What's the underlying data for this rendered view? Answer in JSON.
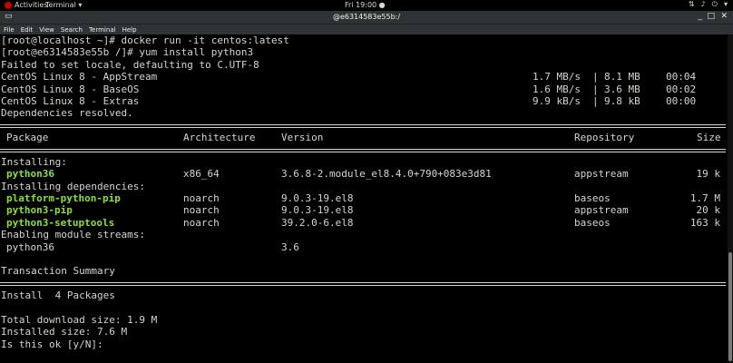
{
  "topbar": {
    "activities": "Activities",
    "app": "Terminal ▾",
    "clock": "Fri 19:00 ●"
  },
  "window": {
    "title": "@e6314583e55b:/"
  },
  "menu": [
    "File",
    "Edit",
    "View",
    "Search",
    "Terminal",
    "Help"
  ],
  "terminal": {
    "cmd1": "[root@localhost ~]# docker run -it centos:latest",
    "cmd2": "[root@e6314583e55b /]# yum install python3",
    "locale": "Failed to set locale, defaulting to C.UTF-8",
    "repos": [
      {
        "name": "CentOS Linux 8 - AppStream",
        "speed": "1.7 MB/s",
        "size": "8.1 MB",
        "time": "00:04"
      },
      {
        "name": "CentOS Linux 8 - BaseOS",
        "speed": "1.6 MB/s",
        "size": "3.6 MB",
        "time": "00:02"
      },
      {
        "name": "CentOS Linux 8 - Extras",
        "speed": "9.9 kB/s",
        "size": "9.8 kB",
        "time": "00:00"
      }
    ],
    "deps_resolved": "Dependencies resolved.",
    "headers": {
      "package": "Package",
      "arch": "Architecture",
      "version": "Version",
      "repo": "Repository",
      "size": "Size"
    },
    "installing": "Installing:",
    "pkg_main": {
      "name": "python36",
      "arch": "x86_64",
      "version": "3.6.8-2.module_el8.4.0+790+083e3d81",
      "repo": "appstream",
      "size": "19 k"
    },
    "installing_deps": "Installing dependencies:",
    "deps": [
      {
        "name": "platform-python-pip",
        "arch": "noarch",
        "version": "9.0.3-19.el8",
        "repo": "baseos",
        "size": "1.7 M"
      },
      {
        "name": "python3-pip",
        "arch": "noarch",
        "version": "9.0.3-19.el8",
        "repo": "appstream",
        "size": "20 k"
      },
      {
        "name": "python3-setuptools",
        "arch": "noarch",
        "version": "39.2.0-6.el8",
        "repo": "baseos",
        "size": "163 k"
      }
    ],
    "enabling": "Enabling module streams:",
    "stream": {
      "name": "python36",
      "version": "3.6"
    },
    "summary": "Transaction Summary",
    "install_count": "Install  4 Packages",
    "download": "Total download size: 1.9 M",
    "installed": "Installed size: 7.6 M",
    "prompt": "Is this ok [y/N]:"
  }
}
